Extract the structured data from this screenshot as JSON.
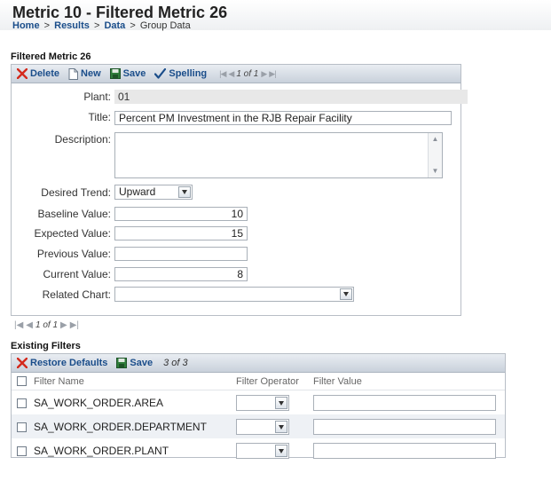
{
  "header": {
    "title": "Metric 10 - Filtered Metric 26",
    "breadcrumb": {
      "home": "Home",
      "results": "Results",
      "data": "Data",
      "current": "Group Data",
      "sep": ">"
    }
  },
  "form_section": {
    "title": "Filtered Metric 26",
    "toolbar": {
      "delete": "Delete",
      "new": "New",
      "save": "Save",
      "spelling": "Spelling",
      "pager_text": "1 of 1"
    },
    "fields": {
      "plant_label": "Plant:",
      "plant_value": "01",
      "title_label": "Title:",
      "title_value": "Percent PM Investment in the RJB Repair Facility",
      "description_label": "Description:",
      "description_value": "",
      "trend_label": "Desired Trend:",
      "trend_value": "Upward",
      "baseline_label": "Baseline Value:",
      "baseline_value": "10",
      "expected_label": "Expected Value:",
      "expected_value": "15",
      "previous_label": "Previous Value:",
      "previous_value": "",
      "current_label": "Current Value:",
      "current_value": "8",
      "chart_label": "Related Chart:",
      "chart_value": ""
    },
    "bottom_pager_text": "1 of 1"
  },
  "filters_section": {
    "title": "Existing Filters",
    "toolbar": {
      "restore": "Restore Defaults",
      "save": "Save",
      "count": "3 of 3"
    },
    "columns": {
      "name": "Filter Name",
      "operator": "Filter Operator",
      "value": "Filter Value"
    },
    "rows": [
      {
        "name": "SA_WORK_ORDER.AREA"
      },
      {
        "name": "SA_WORK_ORDER.DEPARTMENT"
      },
      {
        "name": "SA_WORK_ORDER.PLANT"
      }
    ]
  },
  "colors": {
    "link": "#1a4d8a",
    "delete_red": "#d42a1c",
    "save_green": "#2e7d3a",
    "check_blue": "#1a4d8a"
  },
  "icons": [
    "delete-x-icon",
    "new-page-icon",
    "save-disk-icon",
    "spelling-check-icon",
    "first-page-icon",
    "prev-page-icon",
    "next-page-icon",
    "last-page-icon",
    "dropdown-arrow-icon"
  ]
}
